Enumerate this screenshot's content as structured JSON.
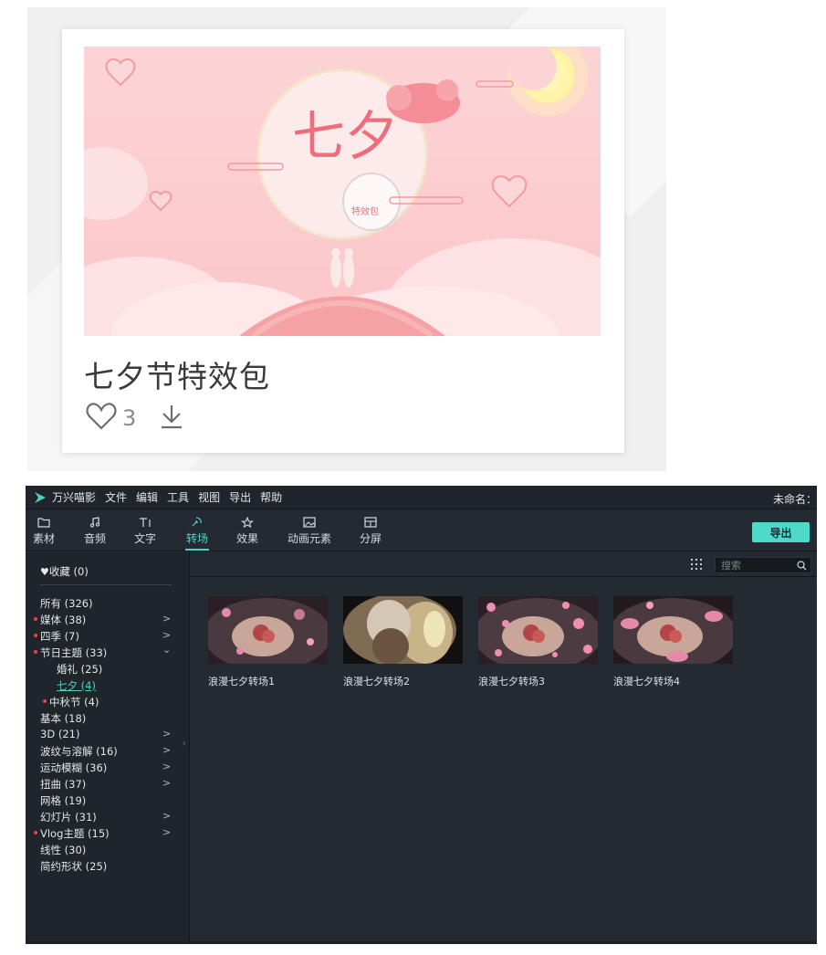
{
  "card": {
    "title": "七夕节特效包",
    "banner_title": "七夕",
    "banner_badge": "特效包",
    "like_count": "3"
  },
  "app": {
    "name": "万兴喵影",
    "menu": [
      "文件",
      "编辑",
      "工具",
      "视图",
      "导出",
      "帮助"
    ],
    "project_name": "未命名：",
    "tools": [
      {
        "label": "素材",
        "icon": "folder-icon"
      },
      {
        "label": "音频",
        "icon": "music-note-icon"
      },
      {
        "label": "文字",
        "icon": "text-icon"
      },
      {
        "label": "转场",
        "icon": "transition-icon"
      },
      {
        "label": "效果",
        "icon": "effects-icon"
      },
      {
        "label": "动画元素",
        "icon": "image-icon"
      },
      {
        "label": "分屏",
        "icon": "split-screen-icon"
      }
    ],
    "active_tool": "转场",
    "export_label": "导出",
    "accent_color": "#4fd1c5"
  },
  "sidebar": {
    "favorites": "收藏 (0)",
    "categories": [
      {
        "label": "所有 (326)"
      },
      {
        "label": "媒体 (38)"
      },
      {
        "label": "四季 (7)"
      },
      {
        "label": "节日主题 (33)"
      },
      {
        "label": "婚礼 (25)"
      },
      {
        "label": "七夕 (4)"
      },
      {
        "label": "中秋节 (4)"
      },
      {
        "label": "基本 (18)"
      },
      {
        "label": "3D (21)"
      },
      {
        "label": "波纹与溶解 (16)"
      },
      {
        "label": "运动模糊 (36)"
      },
      {
        "label": "扭曲 (37)"
      },
      {
        "label": "网格 (19)"
      },
      {
        "label": "幻灯片 (31)"
      },
      {
        "label": "Vlog主题 (15)"
      },
      {
        "label": "线性 (30)"
      },
      {
        "label": "简约形状 (25)"
      }
    ]
  },
  "content": {
    "search_placeholder": "搜索",
    "items": [
      {
        "label": "浪漫七夕转场1"
      },
      {
        "label": "浪漫七夕转场2"
      },
      {
        "label": "浪漫七夕转场3"
      },
      {
        "label": "浪漫七夕转场4"
      }
    ]
  }
}
